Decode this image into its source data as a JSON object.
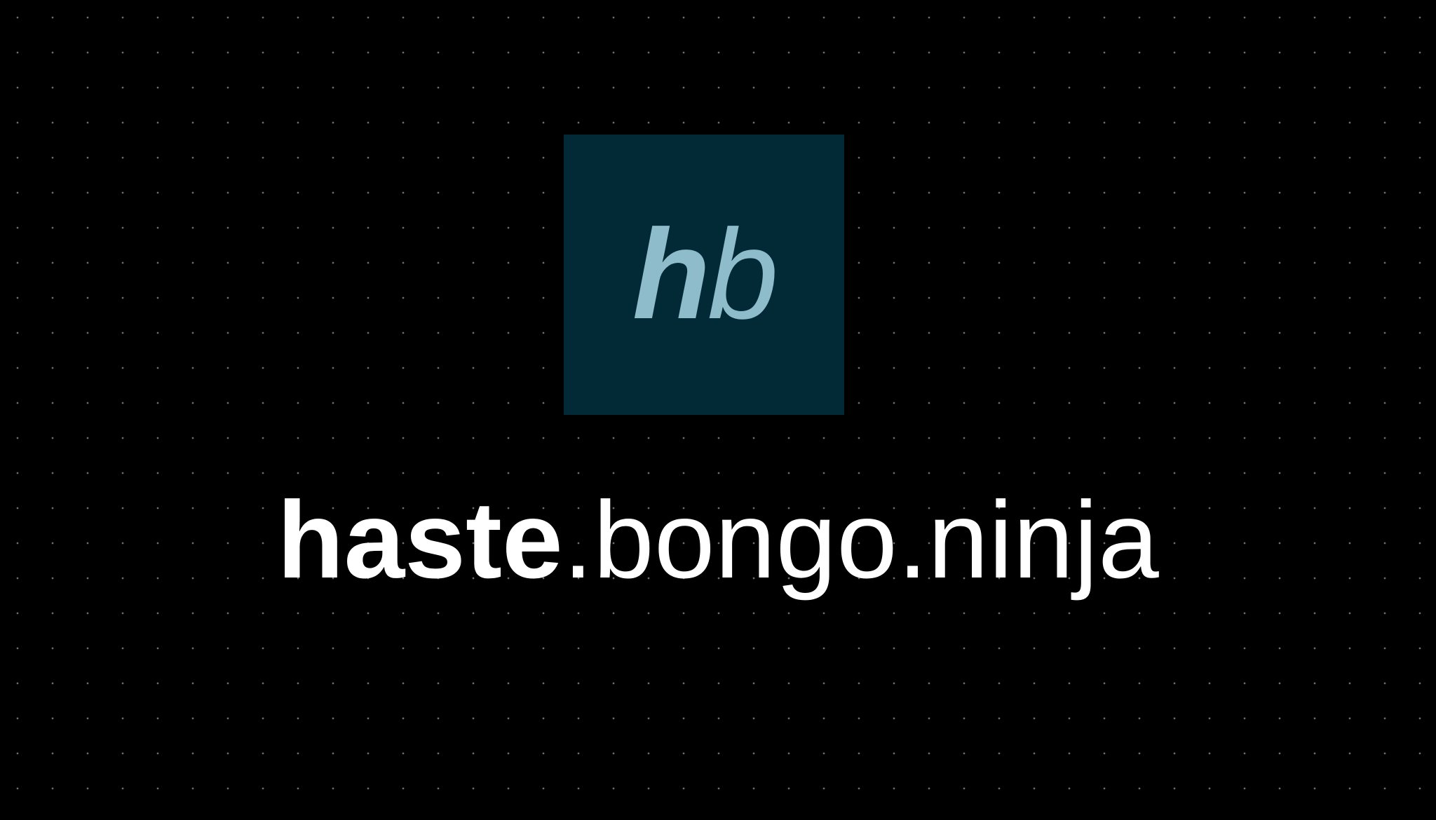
{
  "logo": {
    "letter_1": "h",
    "letter_2": "b",
    "background_color": "#022a36",
    "letter_color": "#8fbccb"
  },
  "title": {
    "bold_part": "haste",
    "regular_part": ".bongo.ninja"
  },
  "background": {
    "color": "#000000",
    "pattern": "dot-grid"
  }
}
